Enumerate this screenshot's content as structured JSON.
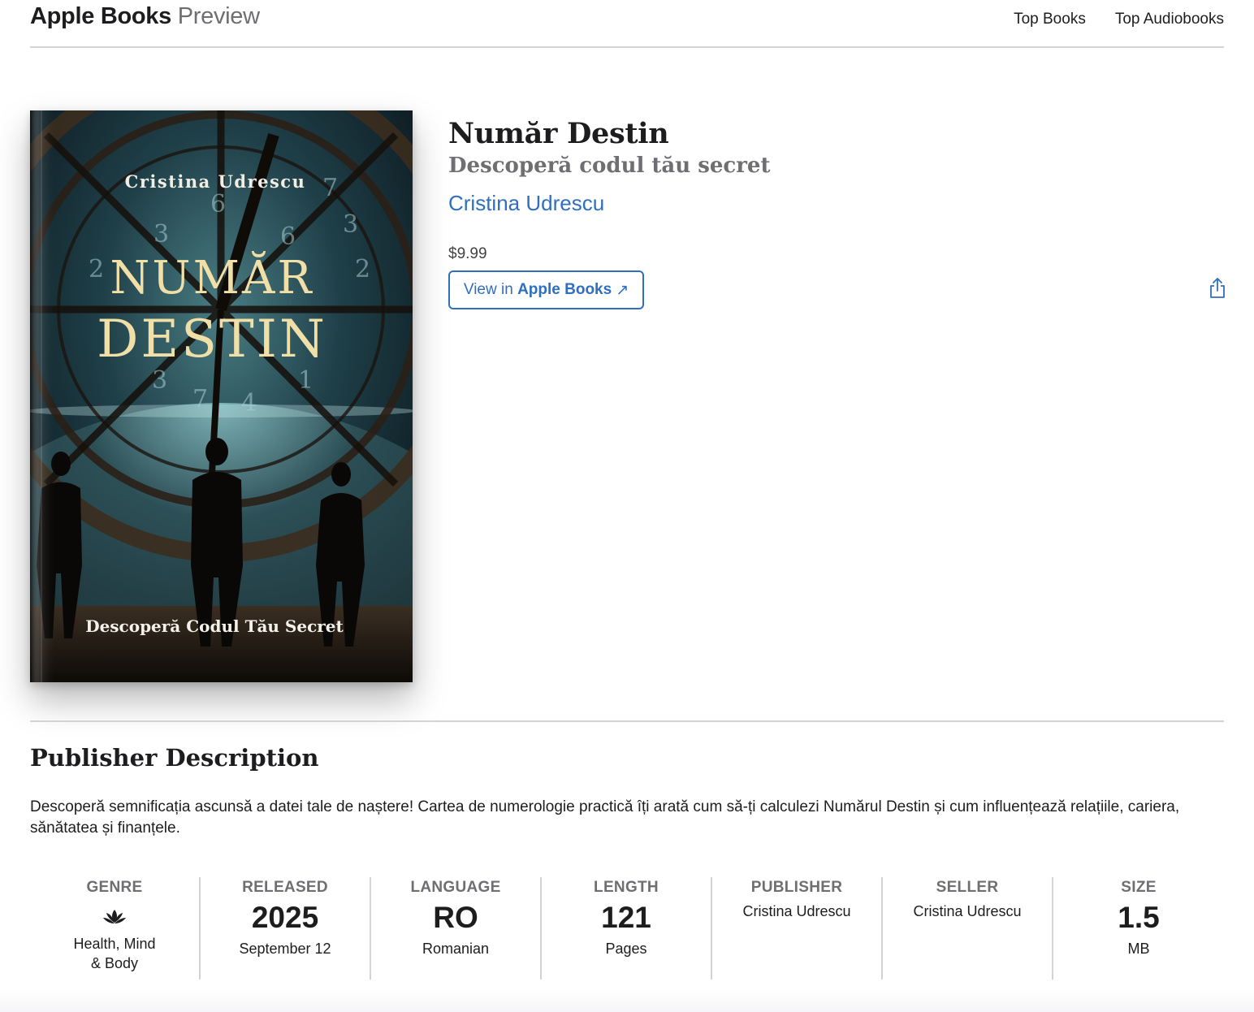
{
  "header": {
    "brand_bold": "Apple Books",
    "brand_light": "Preview",
    "nav": [
      "Top Books",
      "Top Audiobooks"
    ]
  },
  "cover": {
    "author": "Cristina Udrescu",
    "title_line1": "NUMĂR",
    "title_line2": "DESTIN",
    "tagline": "Descoperă Codul Tău Secret"
  },
  "book": {
    "title": "Număr Destin",
    "subtitle": "Descoperă codul tău secret",
    "author": "Cristina Udrescu",
    "price": "$9.99",
    "view_prefix": "View in ",
    "view_strong": "Apple Books",
    "view_arrow": "↗"
  },
  "description": {
    "heading": "Publisher Description",
    "text": "Descoperă semnificația ascunsă a datei tale de naștere! Cartea de numerologie practică îți arată cum să-ți calculezi Numărul Destin și cum influențează relațiile, cariera, sănătatea și finanțele."
  },
  "meta": {
    "genre": {
      "label": "Genre",
      "value": "Health, Mind & Body",
      "icon": "lotus-icon"
    },
    "released": {
      "label": "Released",
      "big": "2025",
      "sub": "September 12"
    },
    "language": {
      "label": "Language",
      "big": "RO",
      "sub": "Romanian"
    },
    "length": {
      "label": "Length",
      "big": "121",
      "sub": "Pages"
    },
    "publisher": {
      "label": "Publisher",
      "value": "Cristina Udrescu"
    },
    "seller": {
      "label": "Seller",
      "value": "Cristina Udrescu"
    },
    "size": {
      "label": "Size",
      "big": "1.5",
      "sub": "MB"
    }
  },
  "colors": {
    "link": "#2f6fbf",
    "muted": "#6e6e73",
    "divider": "#d2d2d7"
  }
}
